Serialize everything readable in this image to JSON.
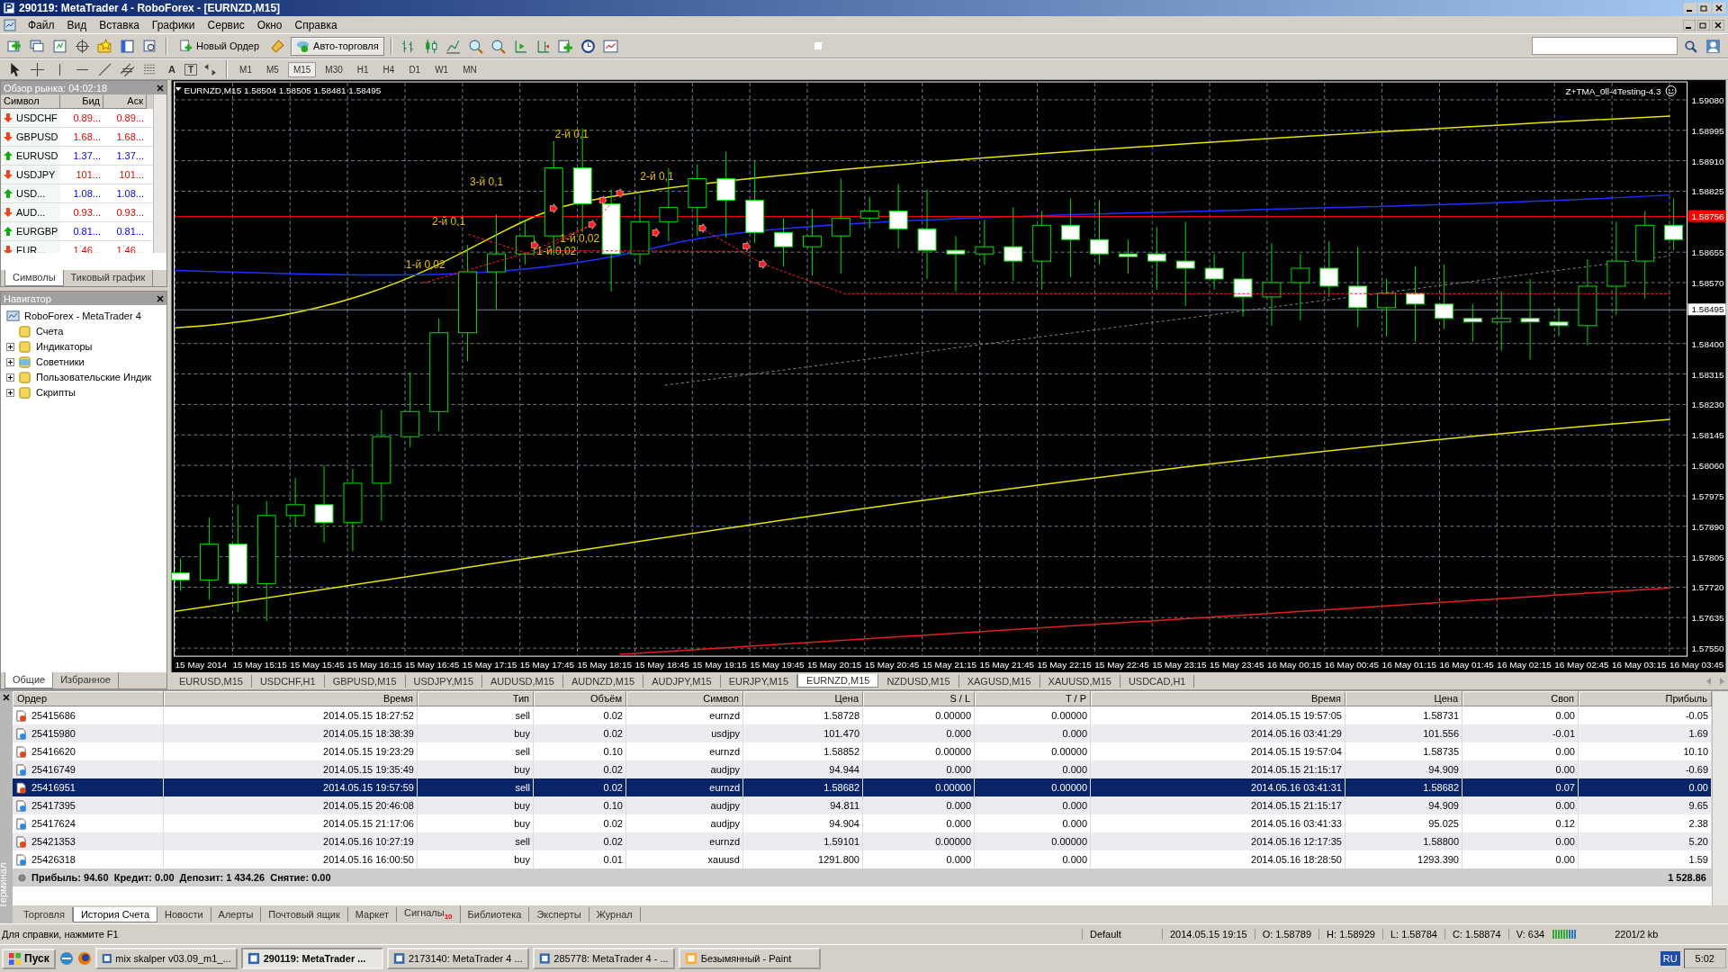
{
  "window": {
    "title": "290119: MetaTrader 4 - RoboForex - [EURNZD,M15]"
  },
  "menu": [
    "Файл",
    "Вид",
    "Вставка",
    "Графики",
    "Сервис",
    "Окно",
    "Справка"
  ],
  "toolbar": {
    "buttons": [
      {
        "label": "Новый Ордер",
        "on": false
      },
      {
        "label": "Авто-торговля",
        "on": true
      }
    ],
    "text_tools": [
      "A",
      "T"
    ],
    "timeframes": [
      {
        "label": "M1",
        "selected": false
      },
      {
        "label": "M5",
        "selected": false
      },
      {
        "label": "M15",
        "selected": true
      },
      {
        "label": "M30",
        "selected": false
      },
      {
        "label": "H1",
        "selected": false
      },
      {
        "label": "H4",
        "selected": false
      },
      {
        "label": "D1",
        "selected": false
      },
      {
        "label": "W1",
        "selected": false
      },
      {
        "label": "MN",
        "selected": false
      }
    ]
  },
  "market_watch": {
    "title": "Обзор рынка: 04:02:18",
    "columns": [
      "Символ",
      "Бид",
      "Аск"
    ],
    "rows": [
      {
        "symbol": "USDCHF",
        "bid": "0.89...",
        "ask": "0.89...",
        "rising": false
      },
      {
        "symbol": "GBPUSD",
        "bid": "1.68...",
        "ask": "1.68...",
        "rising": false
      },
      {
        "symbol": "EURUSD",
        "bid": "1.37...",
        "ask": "1.37...",
        "rising": true
      },
      {
        "symbol": "USDJPY",
        "bid": "101...",
        "ask": "101...",
        "rising": false
      },
      {
        "symbol": "USD...",
        "bid": "1.08...",
        "ask": "1.08...",
        "rising": true
      },
      {
        "symbol": "AUD...",
        "bid": "0.93...",
        "ask": "0.93...",
        "rising": false
      },
      {
        "symbol": "EURGBP",
        "bid": "0.81...",
        "ask": "0.81...",
        "rising": true
      },
      {
        "symbol": "EUR...",
        "bid": "1.46...",
        "ask": "1.46...",
        "rising": false
      }
    ],
    "tabs": [
      {
        "label": "Символы",
        "selected": true
      },
      {
        "label": "Тиковый график",
        "selected": false
      }
    ]
  },
  "navigator": {
    "title": "Навигатор",
    "root": {
      "label": "RoboForex - MetaTrader 4",
      "children": [
        {
          "label": "Счета",
          "expandable": false
        },
        {
          "label": "Индикаторы",
          "expandable": true
        },
        {
          "label": "Советники",
          "expandable": true
        },
        {
          "label": "Пользовательские Индик",
          "expandable": true
        },
        {
          "label": "Скрипты",
          "expandable": true
        }
      ]
    },
    "tabs": [
      {
        "label": "Общие",
        "selected": true
      },
      {
        "label": "Избранное",
        "selected": false
      }
    ]
  },
  "chart": {
    "header": "EURNZD,M15  1.58504 1.58505 1.58481 1.58495",
    "indicator": "Z+TMA_0ll-4Testing-4.3",
    "price_labels": [
      "1.59080",
      "1.58995",
      "1.58910",
      "1.58825",
      "1.58655",
      "1.58570",
      "1.58400",
      "1.58315",
      "1.58230",
      "1.58145",
      "1.58060",
      "1.57975",
      "1.57890",
      "1.57805",
      "1.57720",
      "1.57635",
      "1.57550"
    ],
    "bid_badge": "1.58756",
    "close_badge": "1.58495",
    "time_labels": [
      "15 May 2014",
      "15 May 15:15",
      "15 May 15:45",
      "15 May 16:15",
      "15 May 16:45",
      "15 May 17:15",
      "15 May 17:45",
      "15 May 18:15",
      "15 May 18:45",
      "15 May 19:15",
      "15 May 19:45",
      "15 May 20:15",
      "15 May 20:45",
      "15 May 21:15",
      "15 May 21:45",
      "15 May 22:15",
      "15 May 22:45",
      "15 May 23:15",
      "15 May 23:45",
      "16 May 00:15",
      "16 May 00:45",
      "16 May 01:15",
      "16 May 01:45",
      "16 May 02:15",
      "16 May 02:45",
      "16 May 03:15",
      "16 May 03:45"
    ],
    "trade_labels": [
      "2-й 0,1",
      "3-й 0,1",
      "2-й 0,1",
      "2-й 0,1",
      "1-й 0,02",
      "1-й 0,02",
      "1-й 0,02"
    ]
  },
  "chart_tabs": [
    {
      "label": "EURUSD,M15",
      "selected": false
    },
    {
      "label": "USDCHF,H1",
      "selected": false
    },
    {
      "label": "GBPUSD,M15",
      "selected": false
    },
    {
      "label": "USDJPY,M15",
      "selected": false
    },
    {
      "label": "AUDUSD,M15",
      "selected": false
    },
    {
      "label": "AUDNZD,M15",
      "selected": false
    },
    {
      "label": "AUDJPY,M15",
      "selected": false
    },
    {
      "label": "EURJPY,M15",
      "selected": false
    },
    {
      "label": "EURNZD,M15",
      "selected": true
    },
    {
      "label": "NZDUSD,M15",
      "selected": false
    },
    {
      "label": "XAGUSD,M15",
      "selected": false
    },
    {
      "label": "XAUUSD,M15",
      "selected": false
    },
    {
      "label": "USDCAD,H1",
      "selected": false
    }
  ],
  "terminal": {
    "label": "Терминал",
    "columns": [
      "Ордер",
      "Время",
      "Тип",
      "Объём",
      "Символ",
      "Цена",
      "S / L",
      "T / P",
      "Время",
      "Цена",
      "Своп",
      "Прибыль"
    ],
    "rows": [
      {
        "kind": "sell",
        "selected": false,
        "cells": [
          "25415686",
          "2014.05.15 18:27:52",
          "sell",
          "0.02",
          "eurnzd",
          "1.58728",
          "0.00000",
          "0.00000",
          "2014.05.15 19:57:05",
          "1.58731",
          "0.00",
          "-0.05"
        ]
      },
      {
        "kind": "buy",
        "selected": false,
        "cells": [
          "25415980",
          "2014.05.15 18:38:39",
          "buy",
          "0.02",
          "usdjpy",
          "101.470",
          "0.000",
          "0.000",
          "2014.05.16 03:41:29",
          "101.556",
          "-0.01",
          "1.69"
        ]
      },
      {
        "kind": "sell",
        "selected": false,
        "cells": [
          "25416620",
          "2014.05.15 19:23:29",
          "sell",
          "0.10",
          "eurnzd",
          "1.58852",
          "0.00000",
          "0.00000",
          "2014.05.15 19:57:04",
          "1.58735",
          "0.00",
          "10.10"
        ]
      },
      {
        "kind": "buy",
        "selected": false,
        "cells": [
          "25416749",
          "2014.05.15 19:35:49",
          "buy",
          "0.02",
          "audjpy",
          "94.944",
          "0.000",
          "0.000",
          "2014.05.15 21:15:17",
          "94.909",
          "0.00",
          "-0.69"
        ]
      },
      {
        "kind": "sell",
        "selected": true,
        "cells": [
          "25416951",
          "2014.05.15 19:57:59",
          "sell",
          "0.02",
          "eurnzd",
          "1.58682",
          "0.00000",
          "0.00000",
          "2014.05.16 03:41:31",
          "1.58682",
          "0.07",
          "0.00"
        ]
      },
      {
        "kind": "buy",
        "selected": false,
        "cells": [
          "25417395",
          "2014.05.15 20:46:08",
          "buy",
          "0.10",
          "audjpy",
          "94.811",
          "0.000",
          "0.000",
          "2014.05.15 21:15:17",
          "94.909",
          "0.00",
          "9.65"
        ]
      },
      {
        "kind": "buy",
        "selected": false,
        "cells": [
          "25417624",
          "2014.05.15 21:17:06",
          "buy",
          "0.02",
          "audjpy",
          "94.904",
          "0.000",
          "0.000",
          "2014.05.16 03:41:33",
          "95.025",
          "0.12",
          "2.38"
        ]
      },
      {
        "kind": "sell",
        "selected": false,
        "cells": [
          "25421353",
          "2014.05.16 10:27:19",
          "sell",
          "0.02",
          "eurnzd",
          "1.59101",
          "0.00000",
          "0.00000",
          "2014.05.16 12:17:35",
          "1.58800",
          "0.00",
          "5.20"
        ]
      },
      {
        "kind": "buy",
        "selected": false,
        "cells": [
          "25426318",
          "2014.05.16 16:00:50",
          "buy",
          "0.01",
          "xauusd",
          "1291.800",
          "0.000",
          "0.000",
          "2014.05.16 18:28:50",
          "1293.390",
          "0.00",
          "1.59"
        ]
      }
    ],
    "summary": "Прибыль: 94.60  Кредит: 0.00  Депозит: 1 434.26  Снятие: 0.00",
    "total": "1 528.86",
    "tabs": [
      {
        "label": "Торговля",
        "selected": false
      },
      {
        "label": "История Счета",
        "selected": true
      },
      {
        "label": "Новости",
        "selected": false
      },
      {
        "label": "Алерты",
        "selected": false
      },
      {
        "label": "Почтовый ящик",
        "selected": false
      },
      {
        "label": "Маркет",
        "selected": false
      },
      {
        "label": "Сигналы",
        "selected": false,
        "badge": "10"
      },
      {
        "label": "Библиотека",
        "selected": false
      },
      {
        "label": "Эксперты",
        "selected": false
      },
      {
        "label": "Журнал",
        "selected": false
      }
    ]
  },
  "status_bar": {
    "help": "Для справки, нажмите F1",
    "profile": "Default",
    "fields": [
      "2014.05.15 19:15",
      "O: 1.58789",
      "H: 1.58929",
      "L: 1.58784",
      "C: 1.58874",
      "V: 634"
    ],
    "traffic": "2201/2 kb"
  },
  "taskbar": {
    "start": "Пуск",
    "tasks": [
      {
        "label": "mix skalper v03.09_m1_...",
        "selected": false
      },
      {
        "label": "290119: MetaTrader ...",
        "selected": true
      },
      {
        "label": "2173140: MetaTrader 4 ...",
        "selected": false
      },
      {
        "label": "285778: MetaTrader 4 - ...",
        "selected": false
      },
      {
        "label": "Безымянный - Paint",
        "selected": false
      }
    ],
    "language": "RU",
    "clock": "5:02"
  }
}
